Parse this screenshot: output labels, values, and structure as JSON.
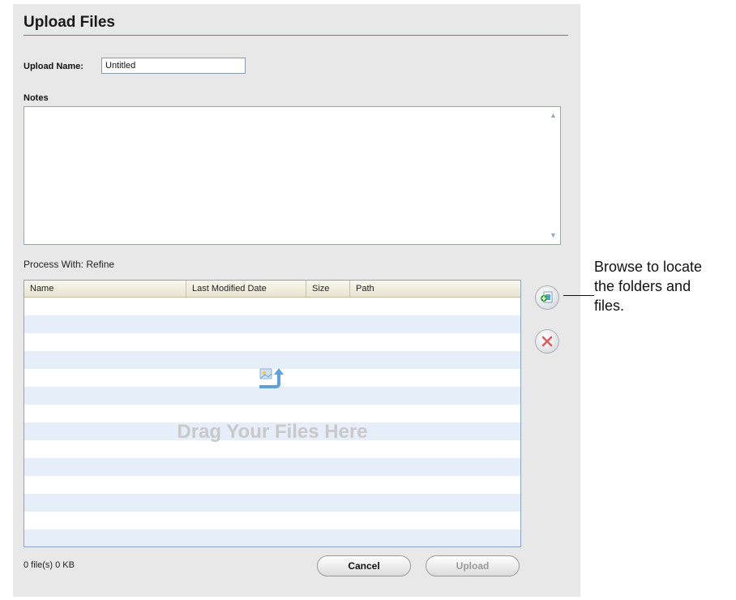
{
  "dialog": {
    "title": "Upload Files",
    "upload_name_label": "Upload Name:",
    "upload_name_value": "Untitled",
    "notes_label": "Notes",
    "notes_value": "",
    "process_with": "Process With: Refine",
    "table": {
      "columns": [
        "Name",
        "Last Modified Date",
        "Size",
        "Path"
      ],
      "rows": [],
      "empty_message": "Drag Your Files Here"
    },
    "status": "0 file(s) 0 KB",
    "buttons": {
      "cancel": "Cancel",
      "upload": "Upload"
    },
    "side_icons": [
      "add-file-icon",
      "remove-icon"
    ]
  },
  "callout": {
    "line1": "Browse to locate",
    "line2": "the folders and",
    "line3": "files."
  },
  "colors": {
    "dialog_bg": "#e8e8e8",
    "row_stripe": "#e6eefa",
    "remove_red": "#e05c5c",
    "add_green": "#2ea52e"
  }
}
